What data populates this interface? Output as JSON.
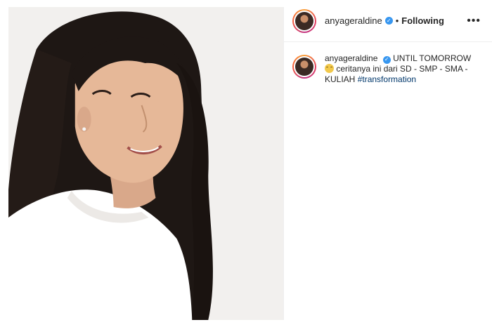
{
  "post": {
    "image_alt": "photo of a young woman with long dark hair in a white t-shirt"
  },
  "header": {
    "username": "anyageraldine",
    "verified_icon": "verified-badge-icon",
    "separator": "•",
    "follow_status": "Following",
    "more_label": "•••"
  },
  "caption": {
    "username": "anyageraldine",
    "text_before_emoji": "UNTIL TOMORROW",
    "emoji_icon": "grinning-face-icon",
    "text_after_emoji": "ceritanya ini dari SD - SMP - SMA - KULIAH",
    "hashtag": "#transformation"
  },
  "colors": {
    "link": "#00376b",
    "verified": "#3897f0",
    "story_ring": "#e4405f"
  }
}
